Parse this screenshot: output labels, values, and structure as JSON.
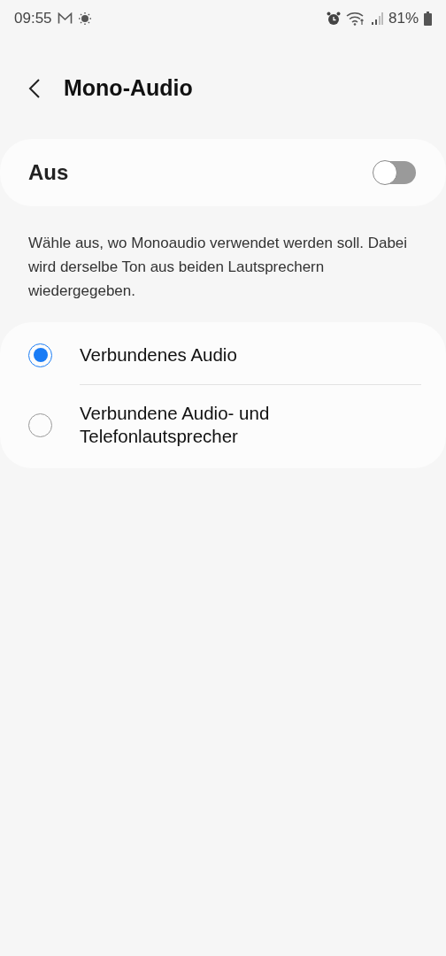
{
  "status_bar": {
    "time": "09:55",
    "battery": "81%"
  },
  "header": {
    "title": "Mono-Audio"
  },
  "master": {
    "label": "Aus",
    "on": false
  },
  "description": "Wähle aus, wo Monoaudio verwendet werden soll. Dabei wird derselbe Ton aus beiden Lautsprechern wiedergegeben.",
  "options": [
    {
      "label": "Verbundenes Audio",
      "selected": true
    },
    {
      "label": "Verbundene Audio- und Telefonlautsprecher",
      "selected": false
    }
  ]
}
